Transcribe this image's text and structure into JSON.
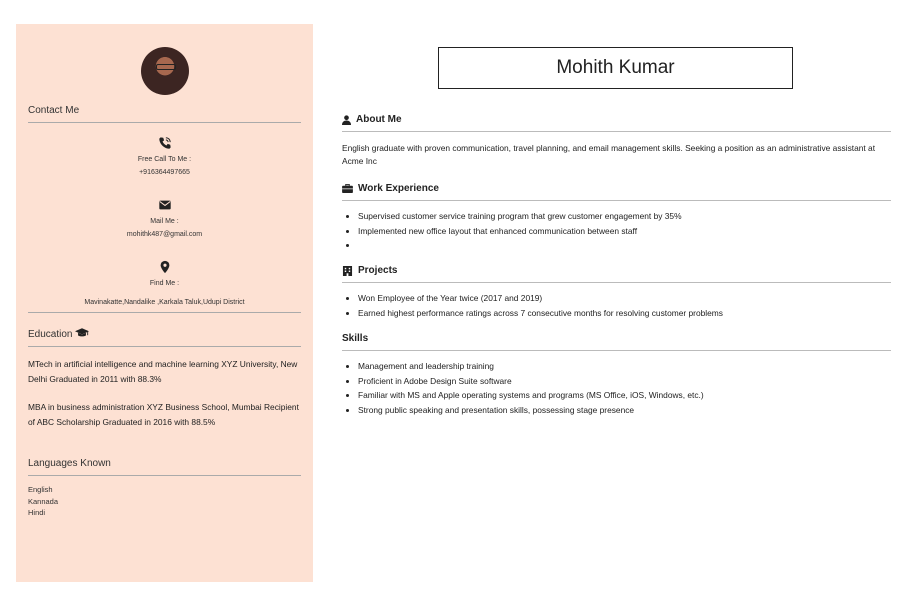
{
  "name": "Mohith Kumar",
  "sidebar": {
    "contact_title": "Contact Me",
    "contacts": [
      {
        "label": "Free Call To Me :",
        "value": "+916364497665"
      },
      {
        "label": "Mail Me :",
        "value": "mohithk487@gmail.com"
      },
      {
        "label": "Find Me :",
        "value": "Mavinakatte,Nandalike ,Karkala Taluk,Udupi District"
      }
    ],
    "education_title": "Education",
    "education": [
      "MTech in artificial intelligence and machine learning XYZ University, New Delhi Graduated in 2011 with 88.3%",
      "MBA in business administration XYZ Business School, Mumbai Recipient of ABC Scholarship Graduated in 2016 with 88.5%"
    ],
    "languages_title": "Languages Known",
    "languages": [
      "English",
      "Kannada",
      "Hindi"
    ]
  },
  "about": {
    "title": "About Me",
    "text": "English graduate with proven communication, travel planning, and email management skills. Seeking a position as an administrative assistant at Acme Inc"
  },
  "work": {
    "title": "Work Experience",
    "items": [
      "Supervised customer service training program that grew customer engagement by 35%",
      "Implemented new office layout that enhanced communication between staff",
      ""
    ]
  },
  "projects": {
    "title": "Projects",
    "items": [
      "Won Employee of the Year twice (2017 and 2019)",
      "Earned highest performance ratings across 7 consecutive months for resolving customer problems"
    ]
  },
  "skills": {
    "title": "Skills",
    "items": [
      "Management and leadership training",
      "Proficient in Adobe Design Suite software",
      "Familiar with MS and Apple operating systems and programs (MS Office, iOS, Windows, etc.)",
      "Strong public speaking and presentation skills, possessing stage presence"
    ]
  }
}
